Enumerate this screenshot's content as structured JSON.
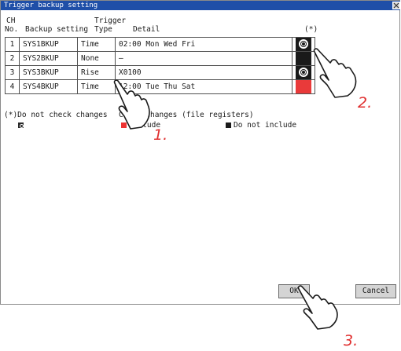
{
  "window": {
    "title": "Trigger backup setting"
  },
  "headers": {
    "ch_line1": "CH",
    "ch_line2": "No.",
    "backup": "Backup setting",
    "type_line1": "Trigger",
    "type_line2": "Type",
    "detail": "Detail",
    "check": "(*)"
  },
  "rows": [
    {
      "no": "1",
      "name": "SYS1BKUP",
      "type": "Time",
      "detail": "02:00 Mon Wed Fri",
      "check": "do-not-check"
    },
    {
      "no": "2",
      "name": "SYS2BKUP",
      "type": "None",
      "detail": "—",
      "check": "do-not-include"
    },
    {
      "no": "3",
      "name": "SYS3BKUP",
      "type": "Rise",
      "detail": "X0100",
      "check": "do-not-check"
    },
    {
      "no": "4",
      "name": "SYS4BKUP",
      "type": "Time",
      "detail": "12:00 Tue Thu Sat",
      "check": "include"
    }
  ],
  "legend": {
    "do_not_check": "(*)Do not check changes",
    "check_changes": "Check changes (file registers)",
    "include": "Include",
    "do_not_include": "Do not include"
  },
  "buttons": {
    "ok": "OK",
    "cancel": "Cancel"
  },
  "steps": [
    "1.",
    "2.",
    "3."
  ],
  "colors": {
    "titlebar": "#1f4fa8",
    "include_red": "#e93a3a",
    "step_red": "#e03030"
  }
}
